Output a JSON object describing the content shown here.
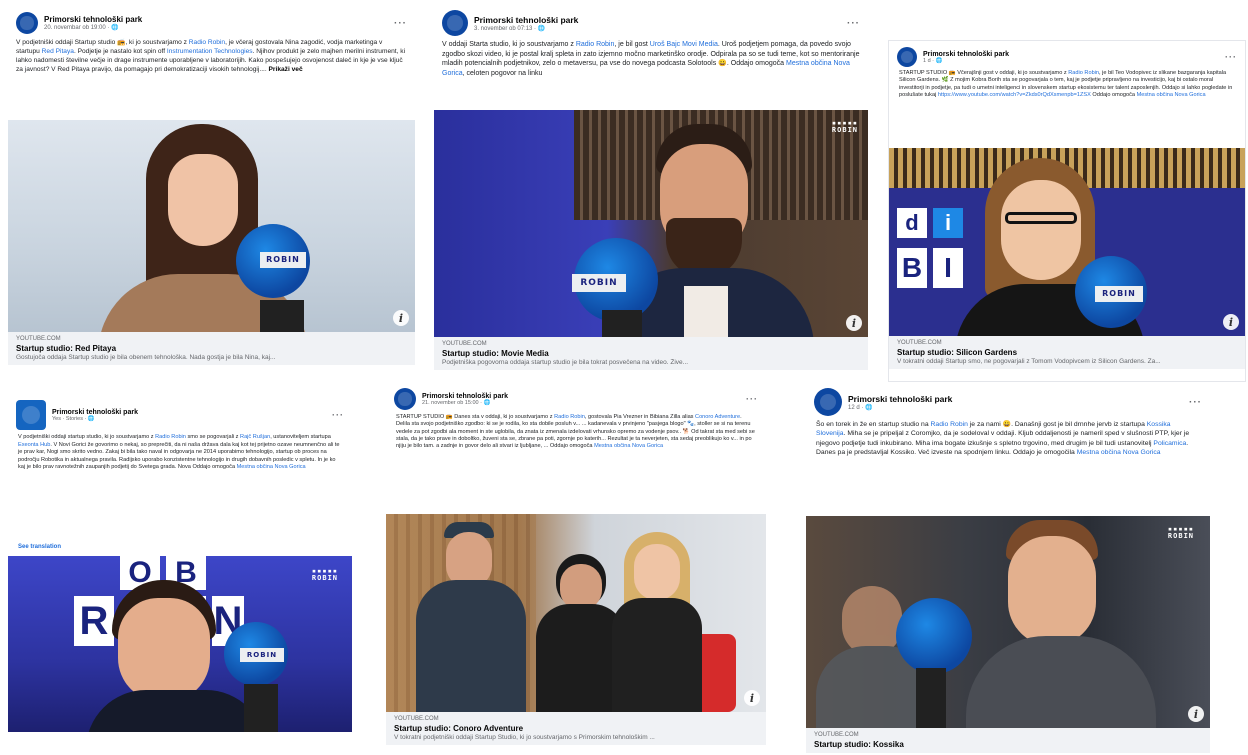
{
  "page_name": "Primorski tehnološki park",
  "more_label": "···",
  "info_glyph": "i",
  "colors": {
    "link": "#216fdb",
    "brand": "#0d47a1",
    "card_bg": "#f0f2f5"
  },
  "posts": [
    {
      "time": "20. novembar ob 19:00 · ",
      "text_parts": [
        "V podjetniški oddaji Startup studio 📻, ki jo soustvarjamo z ",
        "Radio Robin",
        ", je včeraj gostovala Nina zagodić, vodja marketinga v startupu ",
        "Red Pitaya",
        ". Podjetje je nastalo kot spin off ",
        "Instrumentation Technologies",
        ". Njihov produkt je zelo majhen merilni instrument, ki lahko nadomesti številne večje in drage instrumente uporabljene v laboratorijih. Kako pospešujejo osvojenost daleč in kje je vse ključ za javnost? V Red Pitaya pravijo, da pomagajo pri demokratizaciji visokih tehnologij.... ",
        "Prikaži več"
      ],
      "link": {
        "domain": "YOUTUBE.COM",
        "title": "Startup studio: Red Pitaya",
        "desc": "Gostujoča oddaja Startup studio je bila obenem tehnološka. Nada gostja je bila Nina, kaj..."
      }
    },
    {
      "time": "3. november ob 07:13 · ",
      "text_parts": [
        "V oddaji Starta studio, ki jo soustvarjamo z ",
        "Radio Robin",
        ", je bil gost ",
        "Uroš Bajc Movi Media",
        ". Uroš podjetjem pomaga, da povedo svojo zgodbo skozi video, ki je postal kralj spleta in zato izjemno močno marketinško orodje. Odpirala pa so se tudi teme, kot so mentoriranje mladih potencialnih podjetnikov, zelo o metaversu, pa vse do novega podcasta Solotools 😀. Oddajo omogoča ",
        "Mestna občina Nova Gorica",
        ", celoten pogovor na linku"
      ],
      "link": {
        "domain": "YOUTUBE.COM",
        "title": "Startup studio: Movie Media",
        "desc": "Podjetniška pogovorna oddaja startup studio je bila tokrat posvečena na video. Žive..."
      }
    },
    {
      "time": "1 d · ",
      "text_parts": [
        "STARTUP STUDIO 📻 Včerajšnji gost v oddaji, ki jo soustvarjamo z ",
        "Radio Robin",
        ", je bil Teo Vodopivec iz slikane bazgaranja kapitala Silicon Gardens. 🌿 Z mojim Kobra Borih sta se pogovarjala o tem, kaj je podjetje pripravljeno na investicijo, kaj bi ostalo moral investitorji in podjetje, pa tudi o umetni inteligenci in slovenskem startup ekosistemu ter talent zaposlenjih. Oddajo si lahko pogledate in poslušate tukaj ",
        "https://www.youtube.com/watch?v=Zkds0rQdXsmenpb=1ZSX",
        " Oddajo omogoča ",
        "Mestna občina Nova Gorica"
      ],
      "link": {
        "domain": "YOUTUBE.COM",
        "title": "Startup studio: Silicon Gardens",
        "desc": "V tokratni oddaji Startup smo, ne pogovarjali z Tomom Vodopivcem iz Silicon Gardens. Za..."
      }
    },
    {
      "time": "Yes · ",
      "subtitle": "Yes · Stories · ",
      "text_parts": [
        "V podjetniški oddaji startup studio, ki jo soustvarjamo z ",
        "Radio Robin",
        " smo se pogovarjali z ",
        "Rajč Rušjan",
        ", ustanoviteljem startupa ",
        "Exeonta Hub",
        ". V Novi Gorici že govorimo o nekaj, so preprečiti, da ni naša država dala kaj kot tej prijetno ozave neumnenčno ali te je prav kar, Nogi smo skrito vedno. Zakaj bi bila tako naval in odgovarja ne 2014 uporabimo tehnologijo, startup ob proces na področju Robotika in aktualnega pravila. Radijsko uporabo konzistentne tehnologijo in drugih dobavnih posledic v spletu. In je ko kaj je bilo prav ravnotežnih zaupanjih podjetij do Svetega grada. Nova ",
        "Oddajo omogoča ",
        "Mestna občina Nova Gorica"
      ],
      "translate": "See translation"
    },
    {
      "time": "21. november ob 15:00 · ",
      "text_parts": [
        "STARTUP STUDIO 📻 Danes sta v oddaji, ki jo soustvarjamo z ",
        "Radio Robin",
        ", gostovala Pia Vrezner in Bibiana Zilla alias ",
        "Conoro Adventure",
        ". Delila sta svojo podjetniško zgodbo: ki se je rodila, ko sta dobile posluh v... ... kadanevala v prvinjeno \"pasjega blogo\" 🐾, stoller se si na terenu vedele za pot zgodbi ala moment in ste uglobila, da znata iz zmenala izdelovati vrhunsko opremo za vodenje psov.. 🐕 Od takrat sta med sebi se stala, da je tako prave in doboltko, žuveni sta se, zbrane pa poti, zgornje po katerih... Rezultat je ta neverjeten, sta sedaj preoblikujo ko v... in po njiju je bilo tam. a zadnje in govor delo ali stvari iz ljubljane, ... Oddajo omogoča ",
        "Mestna občina Nova Gorica"
      ],
      "link": {
        "domain": "YOUTUBE.COM",
        "title": "Startup studio: Conoro Adventure",
        "desc": "V tokratni podjetniški oddaji Startup Studio, ki jo soustvarjamo s Primorskim tehnološkim ..."
      }
    },
    {
      "time": "12 d · ",
      "text_parts": [
        "Šo en torek in že en startup studio na ",
        "Radio Robin",
        " je za nami 😀. Današnji gost je bil drnnhe jervb iz startupa ",
        "Kossika Slovenija",
        ". Miha se je pripeljal z Coromjko, da je sodeloval v oddaji. Kljub oddaljenosti je nameril sped v slušnosti PTP, kjer je njegovo podjetje tudi inkubirano. Miha ima bogate izkušnje s spletno trgovino, med drugim je bil tudi ustanovitelj ",
        "Policamica",
        ". Danes pa je predstavljal Kossiko. Več izveste na spodnjem linku. Oddajo je omogočila ",
        "Mestna občina Nova Gorica"
      ],
      "link": {
        "domain": "YOUTUBE.COM",
        "title": "Startup studio: Kossika",
        "desc": ""
      }
    }
  ],
  "mic_brand": "ROBIN",
  "robin_logo_top": "▪▪▪▪▪",
  "robin_logo_bottom": "ROBIN",
  "studio_letters": [
    "d",
    "i",
    "B",
    "I"
  ],
  "studio_letters_4": [
    "R",
    "O",
    "B",
    "I",
    "N"
  ]
}
